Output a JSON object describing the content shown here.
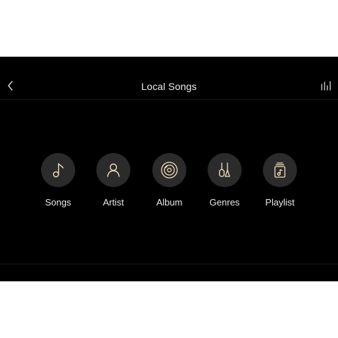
{
  "header": {
    "title": "Local Songs",
    "back_icon": "chevron-left-icon",
    "equalizer_icon": "equalizer-bars-icon"
  },
  "categories": [
    {
      "label": "Songs",
      "icon": "music-note-icon"
    },
    {
      "label": "Artist",
      "icon": "person-icon"
    },
    {
      "label": "Album",
      "icon": "disc-icon"
    },
    {
      "label": "Genres",
      "icon": "instruments-icon"
    },
    {
      "label": "Playlist",
      "icon": "playlist-icon"
    }
  ],
  "colors": {
    "background": "#000000",
    "icon_accent": "#f1dfb8",
    "circle": "#2b2b2b",
    "text": "#e8e8e8"
  }
}
